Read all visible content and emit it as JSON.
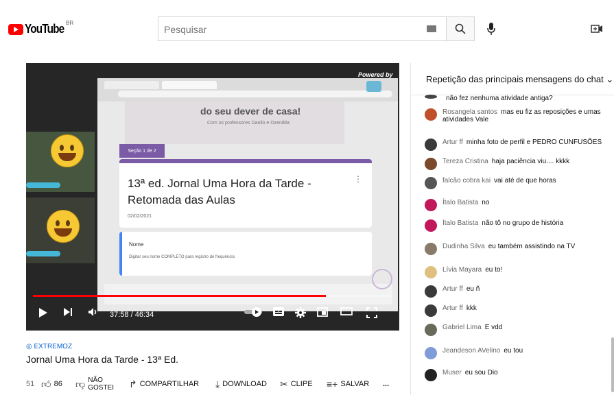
{
  "header": {
    "logo_text": "YouTube",
    "region": "BR",
    "search_placeholder": "Pesquisar",
    "search_icon": "search-icon",
    "mic_icon": "mic-icon",
    "create_icon": "create-video-icon"
  },
  "player": {
    "overlay": {
      "powered_by": "Powered by",
      "banner_text": "do seu dever de casa!",
      "banner_sub": "Com os professores Danilo e Ozenilda",
      "section_tag": "Seção 1 de 2",
      "form_title": "13ª ed. Jornal Uma Hora da Tarde - Retomada das Aulas",
      "form_date": "02/02/2021",
      "name_label": "Nome",
      "name_hint": "Digitar seu nome COMPLETO para registro de frequência"
    },
    "time": "37:58 / 46:34",
    "progress": 0.815
  },
  "video": {
    "location": "EXTREMOZ",
    "title": "Jornal Uma Hora da Tarde - 13ª Ed.",
    "views": "51",
    "likes": "86",
    "dislike_label_1": "NÃO",
    "dislike_label_2": "GOSTEI",
    "share_label": "COMPARTILHAR",
    "download_label": "DOWNLOAD",
    "clip_label": "CLIPE",
    "save_label": "SALVAR",
    "more": "..."
  },
  "chat": {
    "title": "Repetição das principais mensagens do chat",
    "messages": [
      {
        "author": "",
        "text": "não fez nenhuma atividade antiga?",
        "color": "#444444"
      },
      {
        "author": "Rosangela santos",
        "text": "mas eu fiz as reposições e umas atividades Vale",
        "color": "#c0502a"
      },
      {
        "author": "Artur ff",
        "text": "minha foto de perfil e PEDRO CUNFUSÕES",
        "color": "#3a3a3a"
      },
      {
        "author": "Tereza Cristina",
        "text": "haja paciência viu.... kkkk",
        "color": "#7a4a2a"
      },
      {
        "author": "falcão cobra kai",
        "text": "vai até de que horas",
        "color": "#555555"
      },
      {
        "author": "Ítalo Batista",
        "text": "no",
        "color": "#c2185b"
      },
      {
        "author": "Ítalo Batista",
        "text": "não tô no grupo de história",
        "color": "#c2185b"
      },
      {
        "author": "Dudinha Silva",
        "text": "eu também assistindo na TV",
        "color": "#8a7a6a"
      },
      {
        "author": "Lívia Mayara",
        "text": "eu to!",
        "color": "#e0c080"
      },
      {
        "author": "Artur ff",
        "text": "eu ñ",
        "color": "#3a3a3a"
      },
      {
        "author": "Artur ff",
        "text": "kkk",
        "color": "#3a3a3a"
      },
      {
        "author": "Gabriel Lima",
        "text": "E vdd",
        "color": "#6a6a5a"
      },
      {
        "author": "Jeandeson AVelino",
        "text": "eu tou",
        "color": "#7f9bd8"
      },
      {
        "author": "Muser",
        "text": "eu sou Dio",
        "color": "#222222"
      }
    ]
  }
}
